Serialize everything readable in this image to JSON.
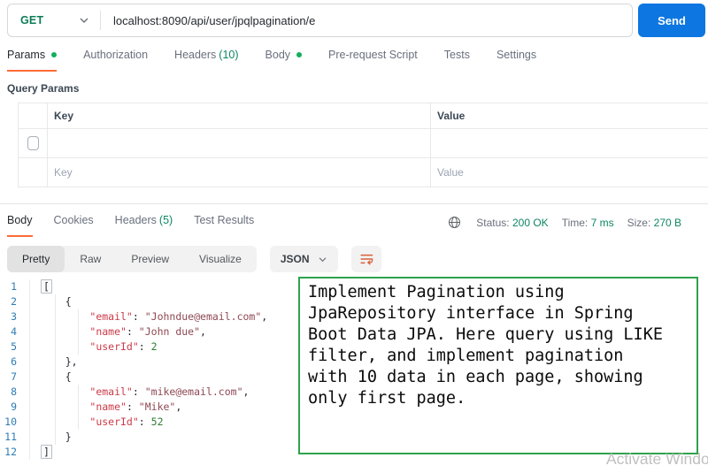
{
  "request": {
    "method": "GET",
    "url": "localhost:8090/api/user/jpqlpagination/e",
    "send_label": "Send",
    "tabs": [
      {
        "label": "Params"
      },
      {
        "label": "Authorization"
      },
      {
        "label": "Headers",
        "count": "(10)"
      },
      {
        "label": "Body"
      },
      {
        "label": "Pre-request Script"
      },
      {
        "label": "Tests"
      },
      {
        "label": "Settings"
      }
    ]
  },
  "query_params": {
    "title": "Query Params",
    "key_header": "Key",
    "value_header": "Value",
    "key_placeholder": "Key",
    "value_placeholder": "Value"
  },
  "response": {
    "tabs": [
      {
        "label": "Body"
      },
      {
        "label": "Cookies"
      },
      {
        "label": "Headers",
        "count": "(5)"
      },
      {
        "label": "Test Results"
      }
    ],
    "meta": [
      {
        "label": "Status:",
        "value": "200 OK"
      },
      {
        "label": "Time:",
        "value": "7 ms"
      },
      {
        "label": "Size:",
        "value": "270 B"
      }
    ],
    "view_tabs": [
      {
        "label": "Pretty"
      },
      {
        "label": "Raw"
      },
      {
        "label": "Preview"
      },
      {
        "label": "Visualize"
      }
    ],
    "language": "JSON",
    "code_lines": [
      {
        "num": "1",
        "tokens": [
          [
            "b",
            "["
          ]
        ]
      },
      {
        "num": "2",
        "tokens": [
          [
            "p",
            "    {"
          ]
        ]
      },
      {
        "num": "3",
        "tokens": [
          [
            "p",
            "        "
          ],
          [
            "k",
            "\"email\""
          ],
          [
            "p",
            ": "
          ],
          [
            "s",
            "\"Johndue@email.com\""
          ],
          [
            "p",
            ","
          ]
        ]
      },
      {
        "num": "4",
        "tokens": [
          [
            "p",
            "        "
          ],
          [
            "k",
            "\"name\""
          ],
          [
            "p",
            ": "
          ],
          [
            "s",
            "\"John due\""
          ],
          [
            "p",
            ","
          ]
        ]
      },
      {
        "num": "5",
        "tokens": [
          [
            "p",
            "        "
          ],
          [
            "k",
            "\"userId\""
          ],
          [
            "p",
            ": "
          ],
          [
            "n",
            "2"
          ]
        ]
      },
      {
        "num": "6",
        "tokens": [
          [
            "p",
            "    },"
          ]
        ]
      },
      {
        "num": "7",
        "tokens": [
          [
            "p",
            "    {"
          ]
        ]
      },
      {
        "num": "8",
        "tokens": [
          [
            "p",
            "        "
          ],
          [
            "k",
            "\"email\""
          ],
          [
            "p",
            ": "
          ],
          [
            "s",
            "\"mike@email.com\""
          ],
          [
            "p",
            ","
          ]
        ]
      },
      {
        "num": "9",
        "tokens": [
          [
            "p",
            "        "
          ],
          [
            "k",
            "\"name\""
          ],
          [
            "p",
            ": "
          ],
          [
            "s",
            "\"Mike\""
          ],
          [
            "p",
            ","
          ]
        ]
      },
      {
        "num": "10",
        "tokens": [
          [
            "p",
            "        "
          ],
          [
            "k",
            "\"userId\""
          ],
          [
            "p",
            ": "
          ],
          [
            "n",
            "52"
          ]
        ]
      },
      {
        "num": "11",
        "tokens": [
          [
            "p",
            "    }"
          ]
        ]
      },
      {
        "num": "12",
        "tokens": [
          [
            "b",
            "]"
          ]
        ]
      }
    ]
  },
  "annotation": {
    "text": "Implement Pagination using\nJpaRepository interface in Spring\nBoot Data JPA. Here query using LIKE\nfilter, and implement pagination\nwith 10 data in each page, showing\nonly first page."
  },
  "watermark": "Activate Windows",
  "colors": {
    "accent_orange": "#ff6c37",
    "status_green": "#0e8662",
    "method_green": "#0c7d57",
    "send_blue": "#0d76e0",
    "annotation_green": "#2fa24c"
  }
}
